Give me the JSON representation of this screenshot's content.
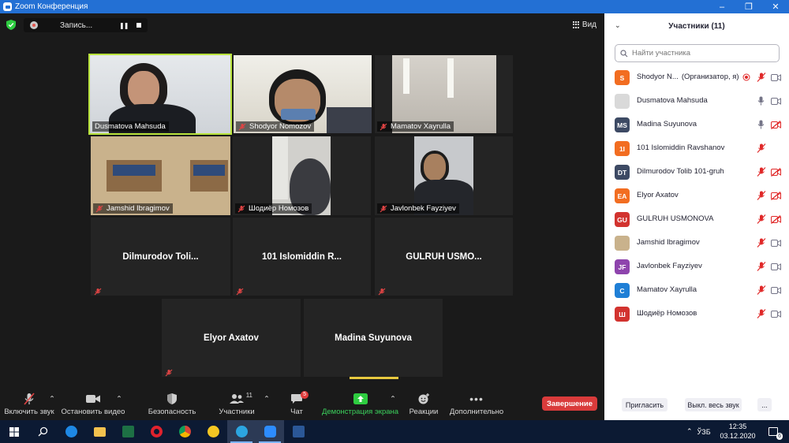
{
  "window": {
    "title": "Zoom Конференция"
  },
  "recording": {
    "label": "Запись..."
  },
  "view": {
    "label": "Вид"
  },
  "tiles": [
    {
      "name": "Dusmatova Mahsuda",
      "muted": false,
      "video": true,
      "active": true
    },
    {
      "name": "Shodyor Nomozov",
      "muted": true,
      "video": true
    },
    {
      "name": "Mamatov Xayrulla",
      "muted": true,
      "video": true
    },
    {
      "name": "Jamshid Ibragimov",
      "muted": true,
      "video": true
    },
    {
      "name": "Шодиёр Номозов",
      "muted": true,
      "video": true
    },
    {
      "name": "Javlonbek Fayziyev",
      "muted": true,
      "video": true
    },
    {
      "name": "Dilmurodov  Toli...",
      "muted": true,
      "video": false
    },
    {
      "name": "101  Islomiddin  R...",
      "muted": true,
      "video": false
    },
    {
      "name": "GULRUH  USMO...",
      "muted": true,
      "video": false
    },
    {
      "name": "Elyor Axatov",
      "muted": true,
      "video": false
    },
    {
      "name": "Madina Suyunova",
      "muted": false,
      "video": false
    }
  ],
  "toolbar": {
    "unmute": "Включить звук",
    "stop_video": "Остановить видео",
    "security": "Безопасность",
    "participants": "Участники",
    "participants_count": "11",
    "chat": "Чат",
    "chat_badge": "5",
    "share": "Демонстрация экрана",
    "reactions": "Реакции",
    "more": "Дополнительно",
    "end": "Завершение"
  },
  "panel": {
    "title": "Участники (11)",
    "search_placeholder": "Найти участника",
    "participants": [
      {
        "initials": "S",
        "color": "#f26d21",
        "name": "Shodyor N...",
        "role": "(Организатор, я)",
        "mic": "muted",
        "cam": "on",
        "recording": true
      },
      {
        "initials": "",
        "color": "#d9d9d9",
        "name": "Dusmatova Mahsuda",
        "mic": "on",
        "cam": "on",
        "img": true
      },
      {
        "initials": "MS",
        "color": "#3d4a64",
        "name": "Madina Suyunova",
        "mic": "on",
        "cam": "off"
      },
      {
        "initials": "1I",
        "color": "#f26d21",
        "name": "101 Islomiddin Ravshanov",
        "mic": "muted",
        "cam": "none"
      },
      {
        "initials": "DT",
        "color": "#3d4a64",
        "name": "Dilmurodov Tolib 101-gruh",
        "mic": "muted",
        "cam": "off"
      },
      {
        "initials": "EA",
        "color": "#f26d21",
        "name": "Elyor Axatov",
        "mic": "muted",
        "cam": "off"
      },
      {
        "initials": "GU",
        "color": "#d2332f",
        "name": "GULRUH USMONOVA",
        "mic": "muted",
        "cam": "off"
      },
      {
        "initials": "",
        "color": "#c9b28c",
        "name": "Jamshid Ibragimov",
        "mic": "muted",
        "cam": "on",
        "img": true
      },
      {
        "initials": "JF",
        "color": "#8e44ad",
        "name": "Javlonbek Fayziyev",
        "mic": "muted",
        "cam": "on"
      },
      {
        "initials": "С",
        "color": "#1f7fd6",
        "name": "Mamatov Xayrulla",
        "mic": "muted",
        "cam": "on"
      },
      {
        "initials": "Ш",
        "color": "#d2332f",
        "name": "Шодиёр Номозов",
        "mic": "muted",
        "cam": "on"
      }
    ],
    "invite": "Пригласить",
    "mute_all": "Выкл. весь звук",
    "more": "..."
  },
  "taskbar": {
    "lang": "ЎЗБ",
    "time": "12:35",
    "date": "03.12.2020",
    "notif": "6"
  }
}
